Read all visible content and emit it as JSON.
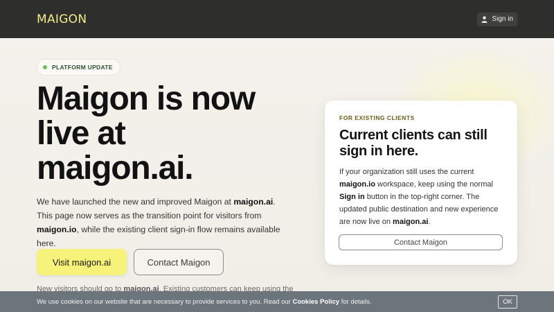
{
  "header": {
    "logo": "MAIGON",
    "signin_label": "Sign in"
  },
  "hero": {
    "badge": "PLATFORM UPDATE",
    "title_line1": "Maigon is now",
    "title_line2": "live at",
    "title_line3": "maigon.ai.",
    "intro": {
      "p1": "We have launched the new and improved Maigon at ",
      "b1": "maigon.ai",
      "p2": ". This page now serves as the transition point for visitors from ",
      "b2": "maigon.io",
      "p3": ", while the existing client sign-in flow remains available here."
    },
    "primary_button": "Visit maigon.ai",
    "secondary_button": "Contact Maigon",
    "note": {
      "p1": "New visitors should go to ",
      "b1": "maigon.ai",
      "p2": ". Existing customers can keep using the"
    }
  },
  "card": {
    "eyebrow": "FOR EXISTING CLIENTS",
    "title": "Current clients can still sign in here.",
    "body": {
      "p1": "If your organization still uses the current ",
      "b1": "maigon.io",
      "p2": " workspace, keep using the normal ",
      "b2": "Sign in",
      "p3": " button in the top-right corner. The updated public destination and new experience are now live on ",
      "b3": "maigon.ai",
      "p4": "."
    },
    "button": "Contact Maigon"
  },
  "cookie": {
    "p1": "We use cookies on our website that are necessary to provide services to you. Read our ",
    "b1": "Cookies Policy",
    "p2": " for details.",
    "ok_label": "OK"
  },
  "colors": {
    "header_bg": "#2e2e2c",
    "logo": "#f0ee8a",
    "primary_button": "#f6f27a",
    "cookie_bg": "#6c747c",
    "badge_dot": "#6bbf5a"
  },
  "icons": {
    "signin": "user-icon"
  }
}
